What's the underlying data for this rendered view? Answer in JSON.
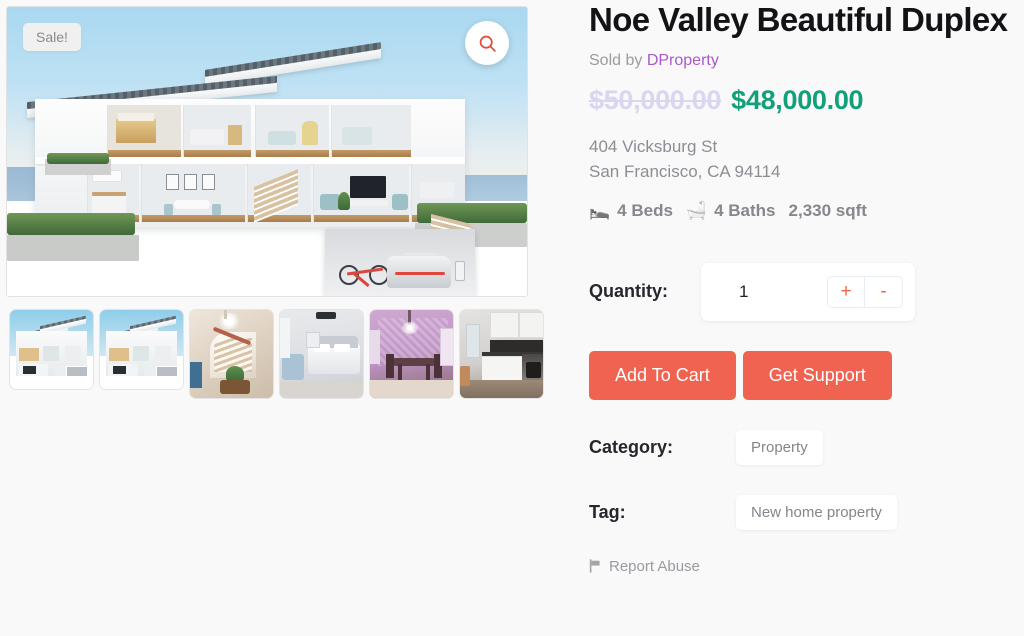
{
  "product": {
    "title": "Noe Valley Beautiful Duplex",
    "sold_by_prefix": "Sold by",
    "vendor": "DProperty",
    "price_old": "$50,000.00",
    "price_new": "$48,000.00",
    "address_line1": "404 Vicksburg St",
    "address_line2": "San Francisco, CA 94114",
    "beds": "4 Beds",
    "baths": "4 Baths",
    "area": "2,330 sqft",
    "beds_icon": "bed-icon",
    "baths_icon": "bathtub-icon"
  },
  "gallery": {
    "sale_badge": "Sale!",
    "zoom_icon": "magnifier-icon",
    "thumbnails": [
      {
        "name": "thumb-house-exterior-1",
        "kind": "house"
      },
      {
        "name": "thumb-house-exterior-2",
        "kind": "house"
      },
      {
        "name": "thumb-staircase",
        "kind": "stair"
      },
      {
        "name": "thumb-bedroom",
        "kind": "bed"
      },
      {
        "name": "thumb-dining-room",
        "kind": "dine"
      },
      {
        "name": "thumb-kitchen",
        "kind": "kitchen"
      }
    ]
  },
  "quantity": {
    "label": "Quantity:",
    "value": "1",
    "increment_label": "+",
    "decrement_label": "-"
  },
  "actions": {
    "add_to_cart": "Add To Cart",
    "get_support": "Get Support"
  },
  "category": {
    "label": "Category:",
    "value": "Property"
  },
  "tag": {
    "label": "Tag:",
    "value": "New home property"
  },
  "report": {
    "label": "Report Abuse",
    "icon": "flag-icon"
  },
  "colors": {
    "accent": "#ef6350",
    "price_sale": "#12a07a",
    "price_old": "#d9d6ef",
    "vendor_link": "#ab59c9",
    "page_bg": "#f9f9fa"
  }
}
